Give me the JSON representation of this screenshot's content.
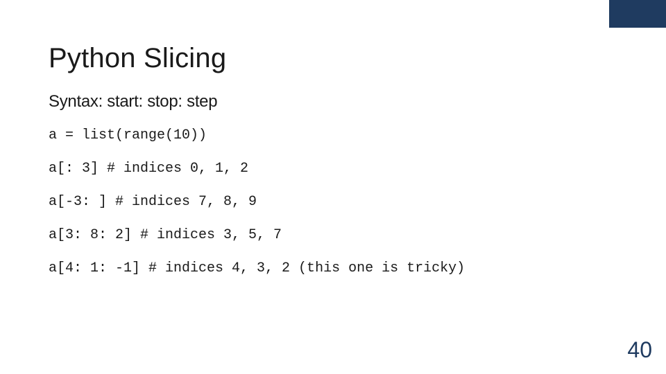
{
  "accent_color": "#1f3b60",
  "title": "Python Slicing",
  "subtitle": "Syntax: start: stop: step",
  "code_lines": [
    "a = list(range(10))",
    "a[: 3] # indices 0, 1, 2",
    "a[-3: ] # indices 7, 8, 9",
    "a[3: 8: 2] # indices 3, 5, 7",
    "a[4: 1: -1] # indices 4, 3, 2 (this one is tricky)"
  ],
  "page_number": "40"
}
